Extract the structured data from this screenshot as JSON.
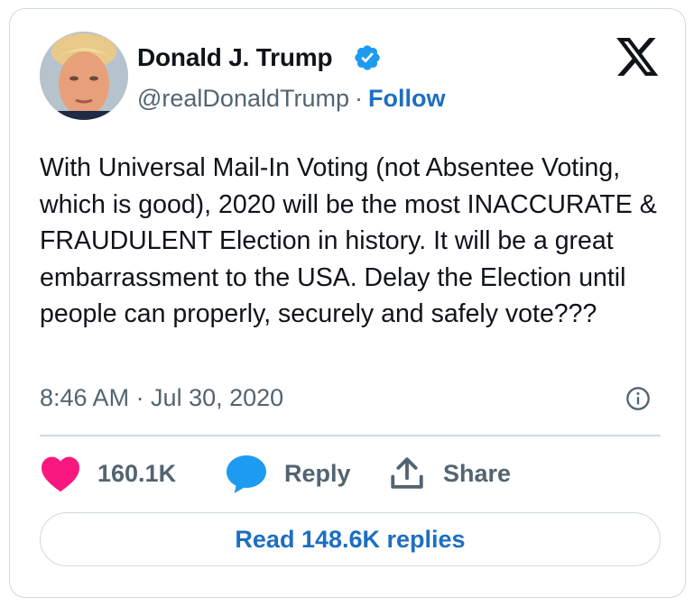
{
  "author": {
    "name": "Donald J. Trump",
    "handle": "@realDonaldTrump",
    "separator": "·",
    "follow_label": "Follow",
    "verified": true
  },
  "tweet": {
    "text": "With Universal Mail-In Voting (not Absentee Voting, which is good), 2020 will be the most INACCURATE & FRAUDULENT Election in history. It will be a great embarrassment to the USA. Delay the Election until people can properly, securely and safely vote???",
    "timestamp": "8:46 AM · Jul 30, 2020"
  },
  "actions": {
    "likes_count": "160.1K",
    "reply_label": "Reply",
    "share_label": "Share",
    "read_replies_label": "Read 148.6K replies"
  },
  "icons": {
    "logo": "x-logo-icon",
    "verified": "verified-badge-icon",
    "info": "info-icon",
    "like": "heart-icon",
    "reply": "speech-bubble-icon",
    "share": "share-upload-icon"
  },
  "colors": {
    "text": "#0f1419",
    "muted": "#536471",
    "link": "#1d6fc2",
    "verified": "#1d9bf0",
    "like": "#f91880",
    "reply": "#1d9bf0",
    "border": "#cfd9de"
  }
}
